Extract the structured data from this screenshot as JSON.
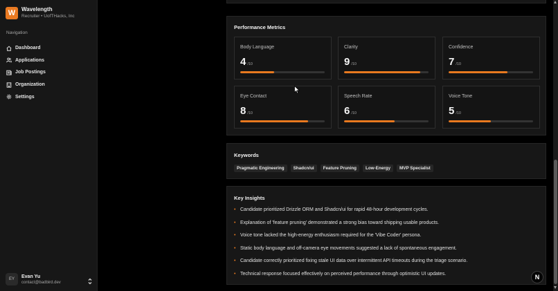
{
  "brand": {
    "logo_letter": "W",
    "name": "Wavelength",
    "subtitle": "Recruiter • UofTHacks, Inc"
  },
  "nav": {
    "heading": "Navigation",
    "items": [
      {
        "label": "Dashboard",
        "icon": "home-icon"
      },
      {
        "label": "Applications",
        "icon": "users-icon"
      },
      {
        "label": "Job Postings",
        "icon": "file-icon"
      },
      {
        "label": "Organization",
        "icon": "building-icon"
      },
      {
        "label": "Settings",
        "icon": "gear-icon"
      }
    ]
  },
  "user": {
    "initials": "EY",
    "name": "Evan Yu",
    "email": "contact@badbird.dev"
  },
  "performance": {
    "title": "Performance Metrics",
    "max_suffix": "/10",
    "metrics": [
      {
        "label": "Body Language",
        "value": 4,
        "progress_pct": 40
      },
      {
        "label": "Clarity",
        "value": 9,
        "progress_pct": 90
      },
      {
        "label": "Confidence",
        "value": 7,
        "progress_pct": 70
      },
      {
        "label": "Eye Contact",
        "value": 8,
        "progress_pct": 80
      },
      {
        "label": "Speech Rate",
        "value": 6,
        "progress_pct": 60
      },
      {
        "label": "Voice Tone",
        "value": 5,
        "progress_pct": 50
      }
    ]
  },
  "keywords": {
    "title": "Keywords",
    "items": [
      "Pragmatic Engineering",
      "Shadcn/ui",
      "Feature Pruning",
      "Low-Energy",
      "MVP Specialist"
    ]
  },
  "insights": {
    "title": "Key Insights",
    "items": [
      "Candidate prioritized Drizzle ORM and Shadcn/ui for rapid 48-hour development cycles.",
      "Explanation of 'feature pruning' demonstrated a strong bias toward shipping usable products.",
      "Voice tone lacked the high-energy enthusiasm required for the 'Vibe Coder' persona.",
      "Static body language and off-camera eye movements suggested a lack of spontaneous engagement.",
      "Candidate correctly prioritized fixing stale UI data over intermittent API timeouts during the triage scenario.",
      "Technical response focused effectively on perceived performance through optimistic UI updates."
    ]
  },
  "fab_label": "N",
  "colors": {
    "accent": "#e8791f",
    "background": "#000000",
    "sidebar": "#171717",
    "card": "#171717"
  }
}
